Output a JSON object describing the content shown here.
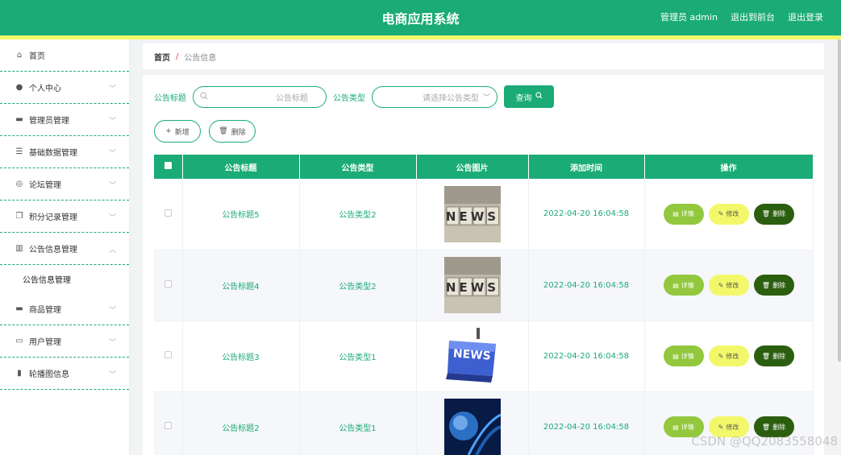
{
  "header": {
    "title": "电商应用系统",
    "links": [
      "管理员 admin",
      "退出到前台",
      "退出登录"
    ]
  },
  "sidebar": {
    "items": [
      {
        "label": "首页",
        "icon": "home-icon",
        "glyph": "⌂",
        "chevron": ""
      },
      {
        "label": "个人中心",
        "icon": "user-icon",
        "glyph": "●",
        "chevron": "﹀"
      },
      {
        "label": "管理员管理",
        "icon": "monitor-icon",
        "glyph": "▬",
        "chevron": "﹀"
      },
      {
        "label": "基础数据管理",
        "icon": "sliders-icon",
        "glyph": "☰",
        "chevron": "﹀"
      },
      {
        "label": "论坛管理",
        "icon": "compass-icon",
        "glyph": "◎",
        "chevron": "﹀"
      },
      {
        "label": "积分记录管理",
        "icon": "copy-icon",
        "glyph": "❐",
        "chevron": "﹀"
      },
      {
        "label": "公告信息管理",
        "icon": "bars-icon",
        "glyph": "▥",
        "chevron": "︿"
      },
      {
        "label": "商品管理",
        "icon": "box-icon",
        "glyph": "▬",
        "chevron": "﹀"
      },
      {
        "label": "用户管理",
        "icon": "id-card-icon",
        "glyph": "▭",
        "chevron": "﹀"
      },
      {
        "label": "轮播图信息",
        "icon": "ticket-icon",
        "glyph": "▮",
        "chevron": "﹀"
      }
    ],
    "submenu": "公告信息管理"
  },
  "breadcrumb": {
    "home": "首页",
    "sep": "/",
    "current": "公告信息"
  },
  "search": {
    "title_label": "公告标题",
    "title_placeholder": "公告标题",
    "type_label": "公告类型",
    "type_placeholder": "请选择公告类型",
    "query_label": "查询"
  },
  "actions": {
    "add_label": "新增",
    "delete_label": "删除"
  },
  "table": {
    "headers": [
      "公告标题",
      "公告类型",
      "公告图片",
      "添加时间",
      "操作"
    ],
    "rows": [
      {
        "title": "公告标题5",
        "type": "公告类型2",
        "time": "2022-04-20 16:04:58",
        "image": "news-blocks"
      },
      {
        "title": "公告标题4",
        "type": "公告类型2",
        "time": "2022-04-20 16:04:58",
        "image": "news-blocks"
      },
      {
        "title": "公告标题3",
        "type": "公告类型1",
        "time": "2022-04-20 16:04:58",
        "image": "news-key"
      },
      {
        "title": "公告标题2",
        "type": "公告类型1",
        "time": "2022-04-20 16:04:58",
        "image": "globe-blue"
      }
    ],
    "op_detail": "详情",
    "op_edit": "修改",
    "op_delete": "删除"
  },
  "watermark": "CSDN @QQ2083558048",
  "colors": {
    "primary": "#1aab76",
    "accent": "#f3f86a",
    "detail": "#93c83e",
    "danger": "#2c5e10"
  }
}
